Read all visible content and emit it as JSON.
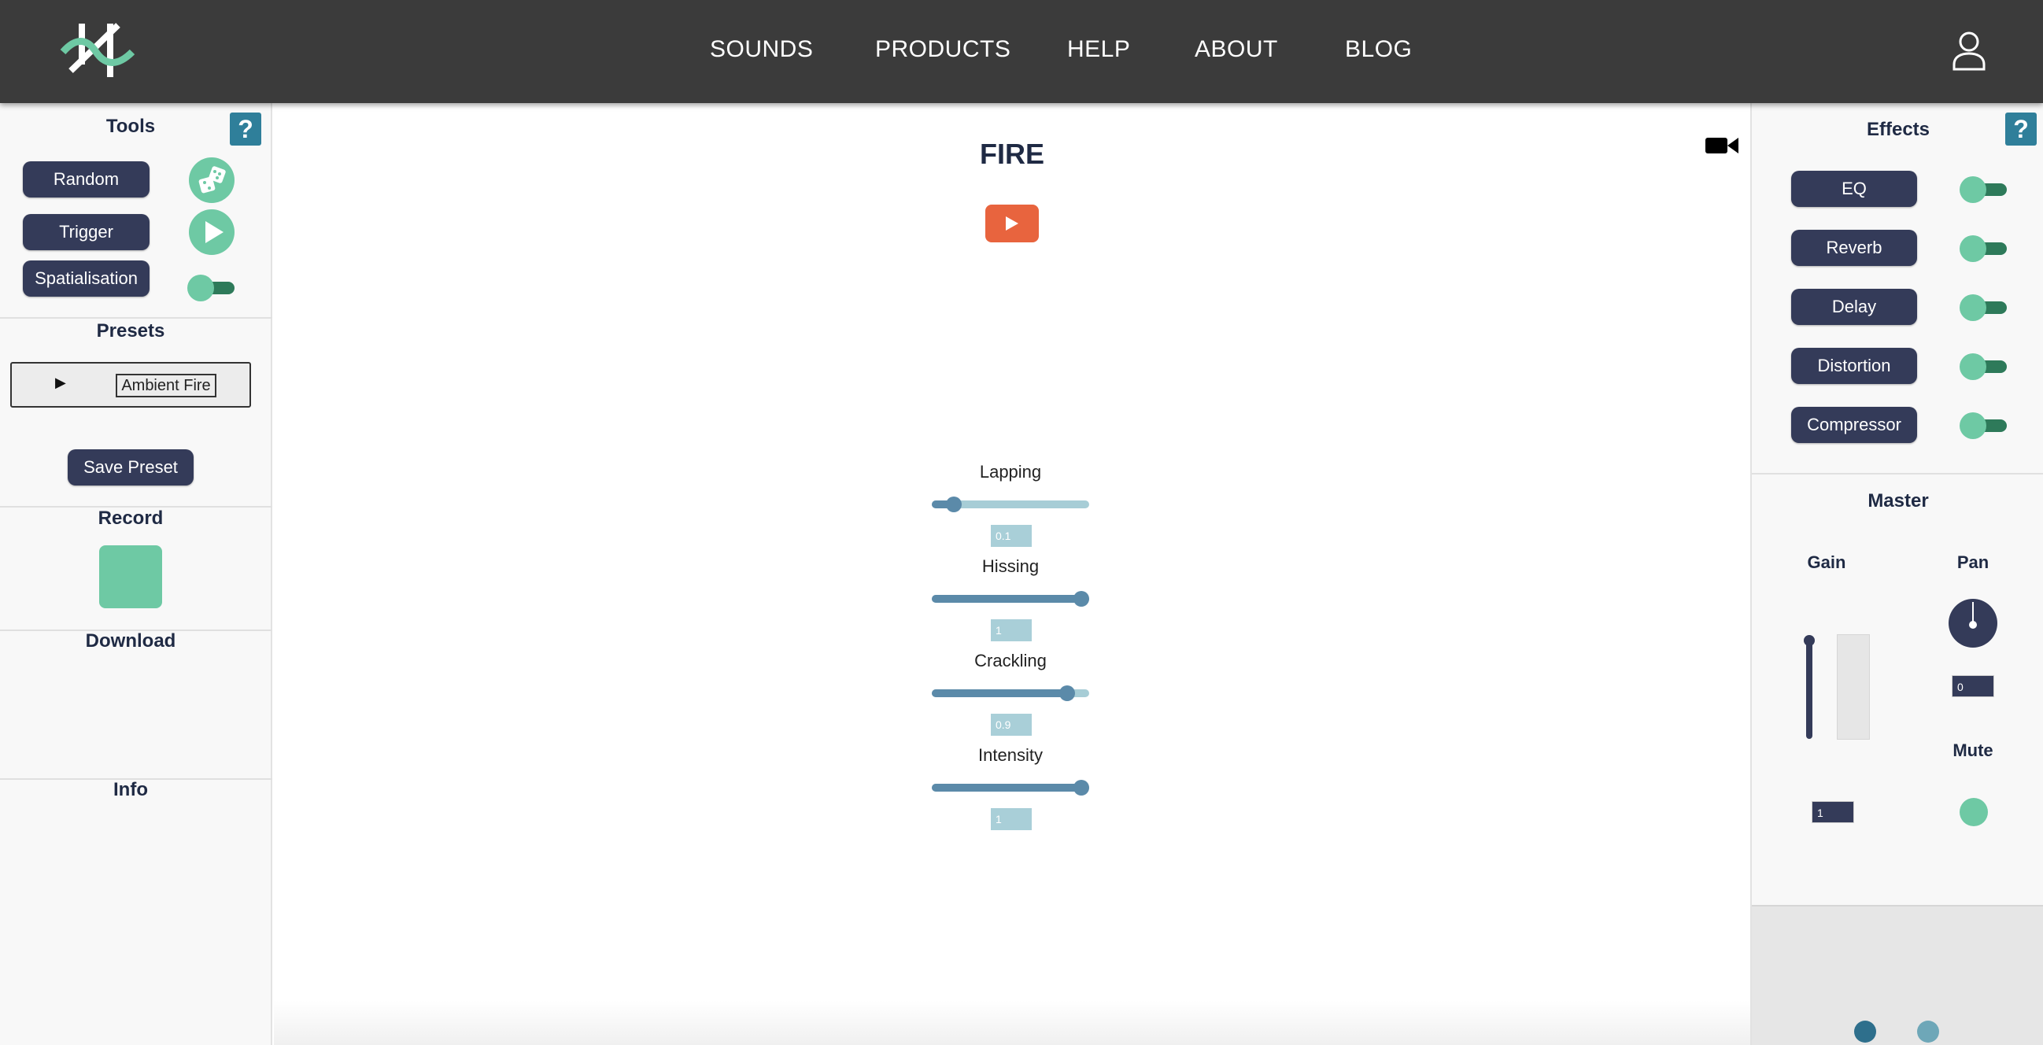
{
  "nav": {
    "items": [
      "SOUNDS",
      "PRODUCTS",
      "HELP",
      "ABOUT",
      "BLOG"
    ]
  },
  "tools": {
    "title": "Tools",
    "help": "?",
    "random_label": "Random",
    "trigger_label": "Trigger",
    "spatialisation_label": "Spatialisation",
    "spatialisation_on": false
  },
  "presets": {
    "title": "Presets",
    "current": "Ambient Fire",
    "save_label": "Save Preset"
  },
  "record": {
    "title": "Record"
  },
  "download": {
    "title": "Download"
  },
  "info": {
    "title": "Info"
  },
  "sound": {
    "title": "FIRE",
    "params": [
      {
        "label": "Lapping",
        "value": "0.1",
        "level": 0.1
      },
      {
        "label": "Hissing",
        "value": "1",
        "level": 1
      },
      {
        "label": "Crackling",
        "value": "0.9",
        "level": 0.9
      },
      {
        "label": "Intensity",
        "value": "1",
        "level": 1
      }
    ]
  },
  "effects": {
    "title": "Effects",
    "help": "?",
    "items": [
      {
        "label": "EQ",
        "on": false
      },
      {
        "label": "Reverb",
        "on": false
      },
      {
        "label": "Delay",
        "on": false
      },
      {
        "label": "Distortion",
        "on": false
      },
      {
        "label": "Compressor",
        "on": false
      }
    ]
  },
  "master": {
    "title": "Master",
    "gain_label": "Gain",
    "pan_label": "Pan",
    "mute_label": "Mute",
    "gain_value": "1",
    "pan_value": "0",
    "gain_level": 1
  },
  "colors": {
    "accent_green": "#6ec9a4",
    "navy": "#343b59",
    "play_orange": "#e8643e",
    "help_teal": "#2f7f9a"
  }
}
